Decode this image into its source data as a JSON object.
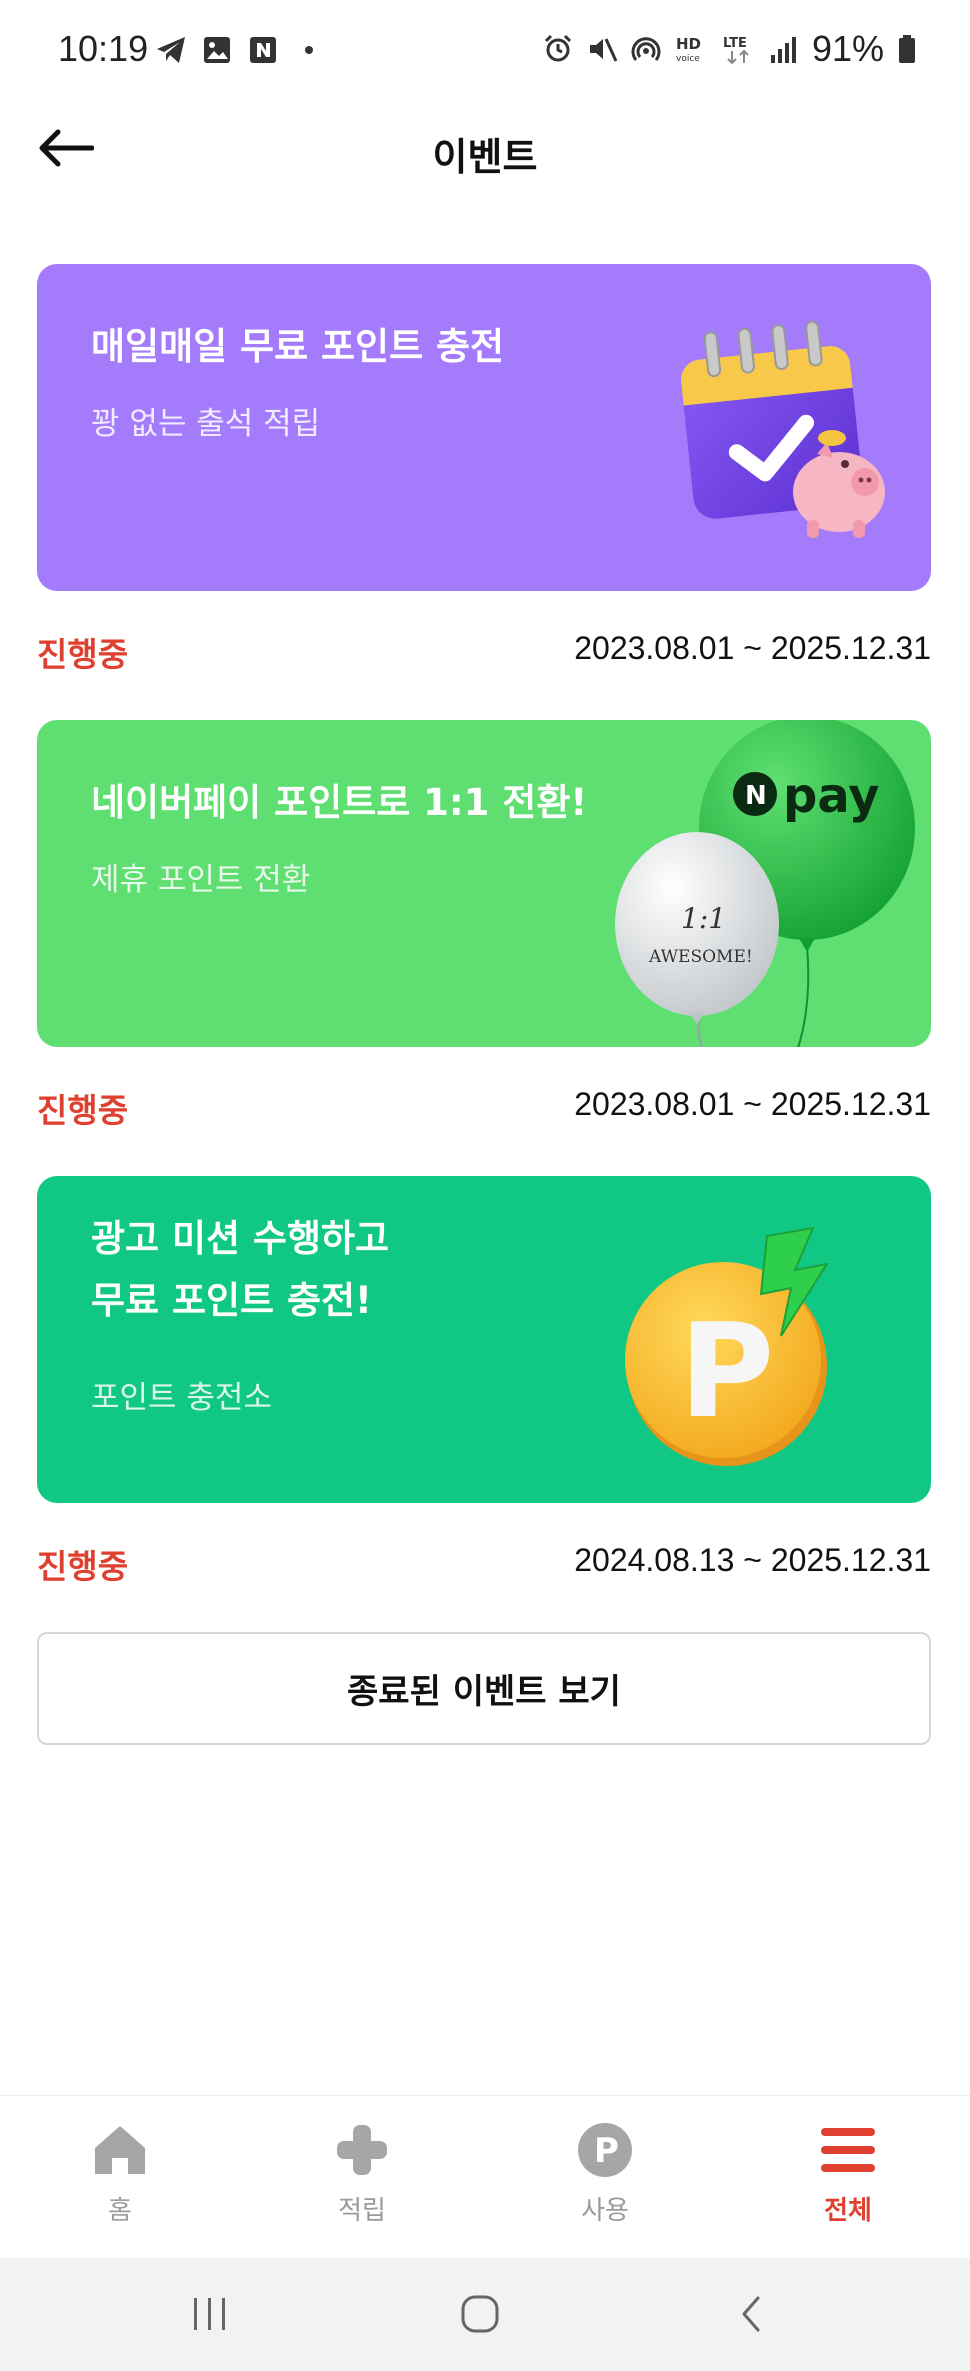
{
  "status_bar": {
    "time": "10:19",
    "battery": "91%",
    "icons_left": [
      "telegram-icon",
      "gallery-icon",
      "naver-icon",
      "dot-icon"
    ],
    "icons_right": [
      "alarm-icon",
      "mute-icon",
      "hotspot-icon",
      "hd-voice-icon",
      "lte-icon",
      "signal-icon",
      "battery-icon"
    ]
  },
  "header": {
    "title": "이벤트",
    "back_icon": "arrow-left-icon"
  },
  "events": [
    {
      "title_lines": [
        "매일매일 무료 포인트 충전"
      ],
      "subtitle": "꽝 없는 출석 적립",
      "bg_color": "#a47bfb",
      "status": "진행중",
      "period": "2023.08.01 ~ 2025.12.31",
      "art": "calendar-piggybank-icon"
    },
    {
      "title_lines": [
        "네이버페이 포인트로 1:1 전환!"
      ],
      "subtitle": "제휴 포인트 전환",
      "bg_color": "#5fdf72",
      "status": "진행중",
      "period": "2023.08.01 ~ 2025.12.31",
      "art": "balloons-icon",
      "balloon_green_text": "pay",
      "balloon_green_badge": "N",
      "balloon_white_line1": "1:1",
      "balloon_white_line2": "AWESOME!"
    },
    {
      "title_lines": [
        "광고 미션 수행하고",
        "무료 포인트 충전!"
      ],
      "subtitle": "포인트 충전소",
      "bg_color": "#10c884",
      "status": "진행중",
      "period": "2024.08.13 ~ 2025.12.31",
      "art": "point-coin-icon",
      "coin_letter": "P"
    }
  ],
  "ended_button": "종료된 이벤트 보기",
  "bottom_nav": [
    {
      "label": "홈",
      "icon": "home-icon",
      "active": false
    },
    {
      "label": "적립",
      "icon": "plus-icon",
      "active": false
    },
    {
      "label": "사용",
      "icon": "point-p-icon",
      "active": false,
      "icon_letter": "P"
    },
    {
      "label": "전체",
      "icon": "menu-icon",
      "active": true
    }
  ],
  "colors": {
    "accent_red": "#e0402f",
    "nav_inactive": "#9a9a9a"
  }
}
